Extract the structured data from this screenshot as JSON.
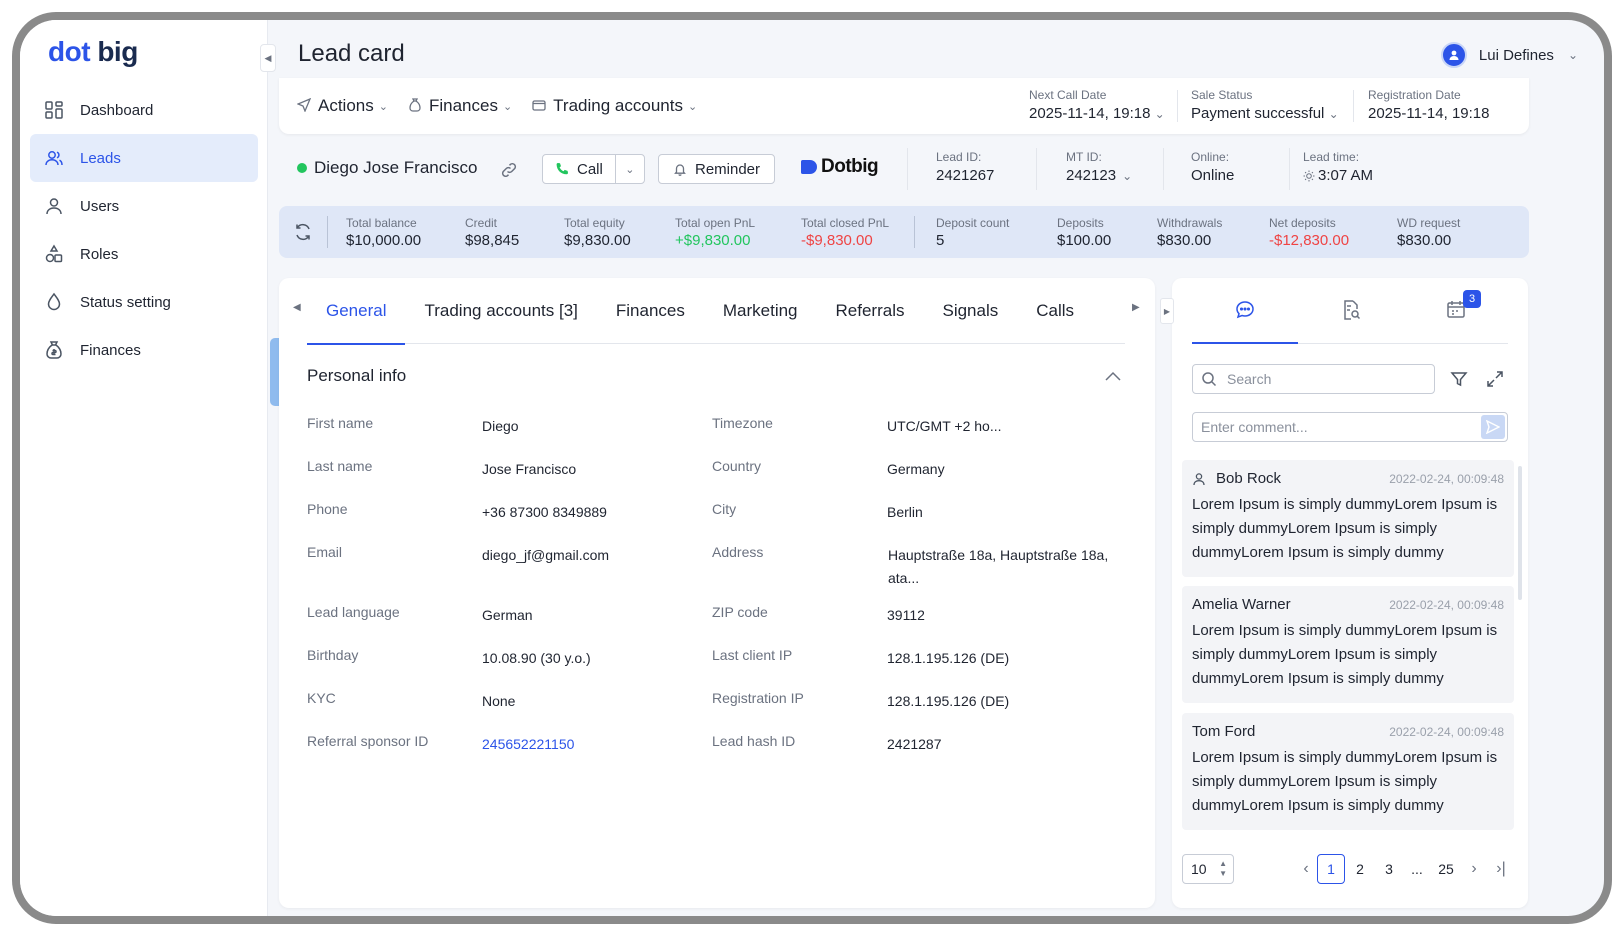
{
  "brand": {
    "part1": "dot",
    "part2": "big"
  },
  "sidebar": {
    "items": [
      {
        "label": "Dashboard",
        "icon": "dashboard-icon"
      },
      {
        "label": "Leads",
        "icon": "users-icon",
        "active": true
      },
      {
        "label": "Users",
        "icon": "user-icon"
      },
      {
        "label": "Roles",
        "icon": "roles-icon"
      },
      {
        "label": "Status setting",
        "icon": "drop-icon"
      },
      {
        "label": "Finances",
        "icon": "money-bag-icon"
      }
    ]
  },
  "header": {
    "title": "Lead card",
    "user_name": "Lui Defines"
  },
  "actionbar": {
    "menus": [
      "Actions",
      "Finances",
      "Trading accounts"
    ],
    "next_call": {
      "label": "Next Call Date",
      "value": "2025-11-14, 19:18"
    },
    "sale_status": {
      "label": "Sale Status",
      "value": "Payment successful"
    },
    "registration": {
      "label": "Registration Date",
      "value": "2025-11-14, 19:18"
    }
  },
  "lead": {
    "name": "Diego Jose Francisco",
    "call_label": "Call",
    "reminder_label": "Reminder",
    "brand_name": "Dotbig",
    "lead_id": {
      "label": "Lead ID:",
      "value": "2421267"
    },
    "mt_id": {
      "label": "MT ID:",
      "value": "242123"
    },
    "online": {
      "label": "Online:",
      "value": "Online"
    },
    "lead_time": {
      "label": "Lead time:",
      "value": "3:07 AM"
    }
  },
  "balance": [
    {
      "label": "Total balance",
      "value": "$10,000.00",
      "tone": ""
    },
    {
      "label": "Credit",
      "value": "$98,845",
      "tone": ""
    },
    {
      "label": "Total equity",
      "value": "$9,830.00",
      "tone": ""
    },
    {
      "label": "Total open PnL",
      "value": "+$9,830.00",
      "tone": "green"
    },
    {
      "label": "Total closed PnL",
      "value": "-$9,830.00",
      "tone": "red"
    },
    {
      "label": "Deposit count",
      "value": "5",
      "tone": ""
    },
    {
      "label": "Deposits",
      "value": "$100.00",
      "tone": ""
    },
    {
      "label": "Withdrawals",
      "value": "$830.00",
      "tone": ""
    },
    {
      "label": "Net deposits",
      "value": "-$12,830.00",
      "tone": "red"
    },
    {
      "label": "WD request",
      "value": "$830.00",
      "tone": ""
    }
  ],
  "tabs": [
    "General",
    "Trading accounts [3]",
    "Finances",
    "Marketing",
    "Referrals",
    "Signals",
    "Calls"
  ],
  "personal": {
    "title": "Personal info",
    "left": [
      {
        "label": "First name",
        "value": "Diego"
      },
      {
        "label": "Last name",
        "value": "Jose Francisco"
      },
      {
        "label": "Phone",
        "value": "+36 87300 8349889"
      },
      {
        "label": "Email",
        "value": "diego_jf@gmail.com"
      },
      {
        "label": "Lead language",
        "value": "German"
      },
      {
        "label": "Birthday",
        "value": "10.08.90 (30 y.o.)"
      },
      {
        "label": "KYC",
        "value": "None"
      },
      {
        "label": "Referral sponsor ID",
        "value": "245652221150",
        "link": true
      }
    ],
    "right": [
      {
        "label": "Timezone",
        "value": "UTC/GMT +2 ho..."
      },
      {
        "label": "Country",
        "value": "Germany"
      },
      {
        "label": "City",
        "value": "Berlin"
      },
      {
        "label": "Address",
        "value": "Hauptstraße 18a, Hauptstraße 18a, ata..."
      },
      {
        "label": "ZIP code",
        "value": "39112"
      },
      {
        "label": "Last client IP",
        "value": "128.1.195.126 (DE)"
      },
      {
        "label": "Registration IP",
        "value": "128.1.195.126 (DE)"
      },
      {
        "label": "Lead hash ID",
        "value": "2421287"
      }
    ]
  },
  "comments_panel": {
    "badge_count": "3",
    "search_placeholder": "Search",
    "comment_placeholder": "Enter comment...",
    "comments": [
      {
        "author": "Bob Rock",
        "time": "2022-02-24, 00:09:48",
        "text": "Lorem Ipsum is simply dummyLorem Ipsum is simply dummyLorem Ipsum is simply dummyLorem Ipsum is simply dummy"
      },
      {
        "author": "Amelia Warner",
        "time": "2022-02-24, 00:09:48",
        "text": "Lorem Ipsum is simply dummyLorem Ipsum is simply dummyLorem Ipsum is simply dummyLorem Ipsum is simply dummy"
      },
      {
        "author": "Tom Ford",
        "time": "2022-02-24, 00:09:48",
        "text": "Lorem Ipsum is simply dummyLorem Ipsum is simply dummyLorem Ipsum is simply dummyLorem Ipsum is simply dummy"
      }
    ],
    "page_size": "10",
    "pages": [
      "1",
      "2",
      "3",
      "...",
      "25"
    ],
    "current_page": "1"
  },
  "colors": {
    "accent": "#2c54e8",
    "positive": "#22c55e",
    "negative": "#ef4444",
    "balance_bg": "#dfe7f7"
  }
}
